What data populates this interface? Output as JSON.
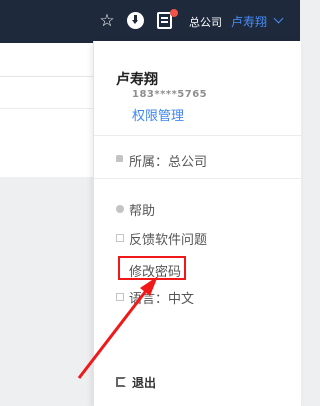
{
  "topbar": {
    "icons": [
      "star-icon",
      "download-icon",
      "message-icon"
    ],
    "company": "总公司",
    "user": "卢寿翔"
  },
  "dropdown": {
    "username": "卢寿翔",
    "phone": "183****5765",
    "permission_link": "权限管理",
    "org": "所属：总公司",
    "help": "帮助",
    "feedback": "反馈软件问题",
    "change_password": "修改密码",
    "language": "语言：中文",
    "logout": "退出"
  },
  "annotation": {
    "highlight_color": "#f01818",
    "target": "修改密码"
  }
}
